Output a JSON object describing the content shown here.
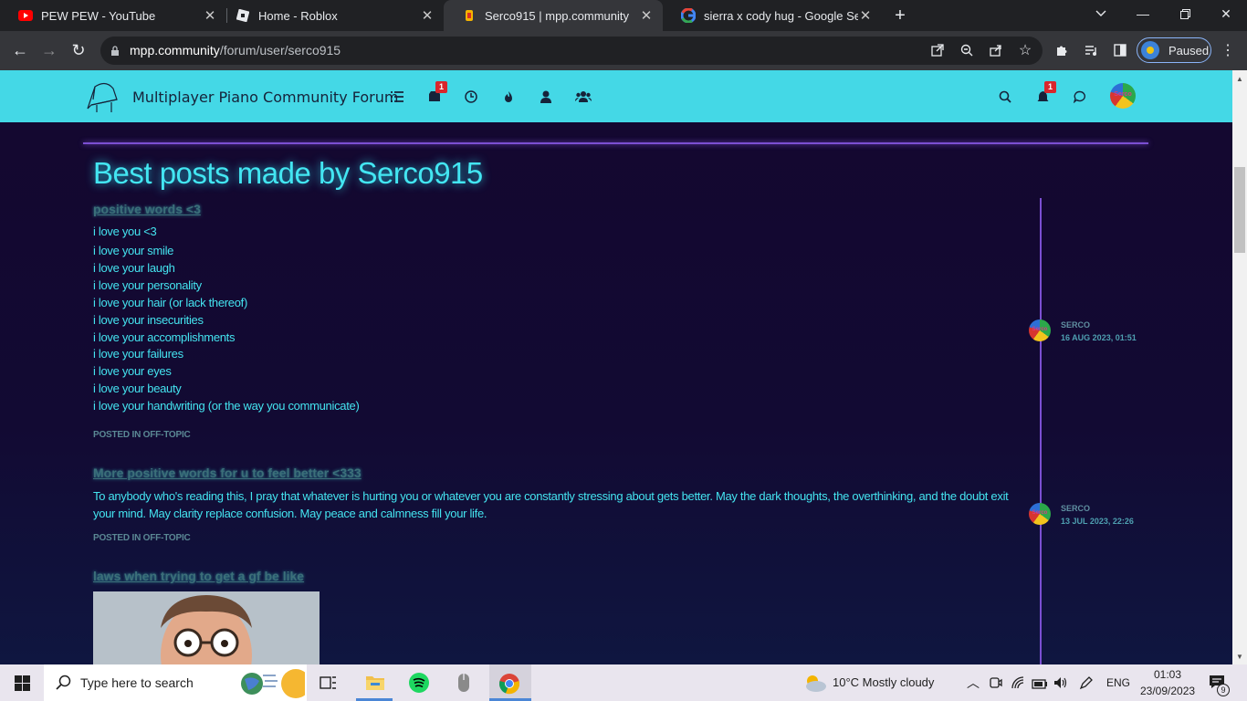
{
  "browser": {
    "tabs": [
      {
        "title": "PEW PEW - YouTube",
        "favicon": "youtube-icon",
        "active": false
      },
      {
        "title": "Home - Roblox",
        "favicon": "roblox-icon",
        "active": false
      },
      {
        "title": "Serco915 | mpp.community",
        "favicon": "mpp-icon",
        "active": true
      },
      {
        "title": "sierra x cody hug - Google Search",
        "favicon": "google-icon",
        "active": false
      }
    ],
    "url_host": "mpp.community",
    "url_path": "/forum/user/serco915",
    "profile_label": "Paused"
  },
  "site": {
    "brand": "Multiplayer Piano Community Forum",
    "chat_badge": "1",
    "notif_badge": "1",
    "avatar_text": "Serco",
    "accent": "#44d8e6"
  },
  "page": {
    "heading": "Best posts made by Serco915",
    "posts": [
      {
        "title": "positive words <3",
        "lines": [
          "i love you <3",
          "i love your smile",
          "i love your laugh",
          "i love your personality",
          "i love your hair (or lack thereof)",
          "i love your insecurities",
          "i love your accomplishments",
          "i love your failures",
          "i love your eyes",
          "i love your beauty",
          "i love your handwriting (or the way you communicate)"
        ],
        "category": "POSTED IN OFF-TOPIC",
        "author": "SERCO",
        "date": "16 AUG 2023, 01:51"
      },
      {
        "title": "More positive words for u to feel better <333",
        "text": "To anybody who's reading this, I pray that whatever is hurting you or whatever you are constantly stressing about gets better. May the dark thoughts, the overthinking, and the doubt exit your mind. May clarity replace confusion. May peace and calmness fill your life.",
        "category": "POSTED IN OFF-TOPIC",
        "author": "SERCO",
        "date": "13 JUL 2023, 22:26"
      },
      {
        "title": "laws when trying to get a gf be like"
      }
    ]
  },
  "taskbar": {
    "search_placeholder": "Type here to search",
    "weather": "10°C  Mostly cloudy",
    "lang": "ENG",
    "time": "01:03",
    "date": "23/09/2023",
    "notif_count": "9"
  }
}
